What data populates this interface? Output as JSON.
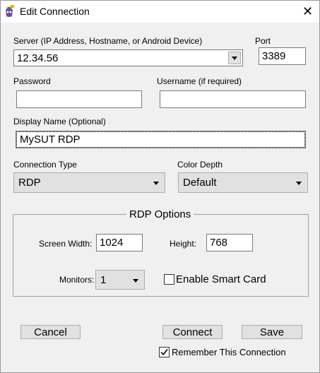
{
  "window": {
    "title": "Edit Connection",
    "close_glyph": "✕"
  },
  "server": {
    "label": "Server (IP Address, Hostname, or Android Device)",
    "value": "12.34.56"
  },
  "port": {
    "label": "Port",
    "value": "3389"
  },
  "password": {
    "label": "Password",
    "value": ""
  },
  "username": {
    "label": "Username (if required)",
    "value": ""
  },
  "display_name": {
    "label": "Display Name (Optional)",
    "value": "MySUT RDP"
  },
  "connection_type": {
    "label": "Connection Type",
    "value": "RDP"
  },
  "color_depth": {
    "label": "Color Depth",
    "value": "Default"
  },
  "rdp_options": {
    "title": "RDP Options",
    "screen_width_label": "Screen Width:",
    "screen_width": "1024",
    "height_label": "Height:",
    "height": "768",
    "monitors_label": "Monitors:",
    "monitors": "1",
    "smart_card_label": "Enable Smart Card",
    "smart_card_checked": false
  },
  "buttons": {
    "cancel": "Cancel",
    "connect": "Connect",
    "save": "Save"
  },
  "remember": {
    "label": "Remember This Connection",
    "checked": true
  }
}
